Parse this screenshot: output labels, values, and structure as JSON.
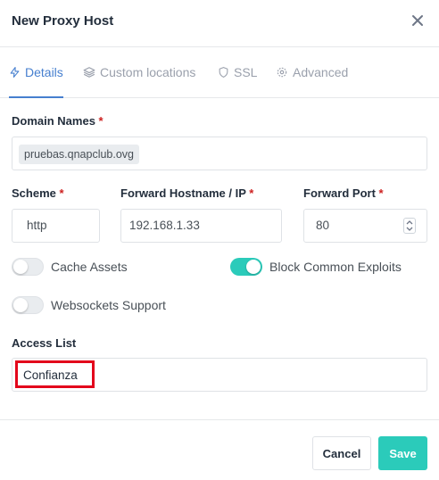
{
  "modal": {
    "title": "New Proxy Host"
  },
  "tabs": [
    {
      "label": "Details",
      "icon": "zap-icon",
      "active": true
    },
    {
      "label": "Custom locations",
      "icon": "layers-icon"
    },
    {
      "label": "SSL",
      "icon": "shield-icon"
    },
    {
      "label": "Advanced",
      "icon": "gear-icon"
    }
  ],
  "form": {
    "domain_names": {
      "label": "Domain Names",
      "required": "*",
      "values": [
        "pruebas.qnapclub.ovg"
      ]
    },
    "scheme": {
      "label": "Scheme",
      "required": "*",
      "value": "http"
    },
    "forward_hostname": {
      "label": "Forward Hostname / IP",
      "required": "*",
      "value": "192.168.1.33"
    },
    "forward_port": {
      "label": "Forward Port",
      "required": "*",
      "value": "80"
    },
    "toggles": {
      "cache_assets": {
        "label": "Cache Assets",
        "on": false
      },
      "block_exploits": {
        "label": "Block Common Exploits",
        "on": true
      },
      "websockets": {
        "label": "Websockets Support",
        "on": false
      }
    },
    "access_list": {
      "label": "Access List",
      "value": "Confianza"
    }
  },
  "footer": {
    "cancel_label": "Cancel",
    "save_label": "Save"
  },
  "colors": {
    "accent": "#467fcf",
    "toggle_on": "#2bcbba",
    "save_button": "#2bcbba",
    "required": "#cd201f",
    "highlight": "#e3051b"
  }
}
